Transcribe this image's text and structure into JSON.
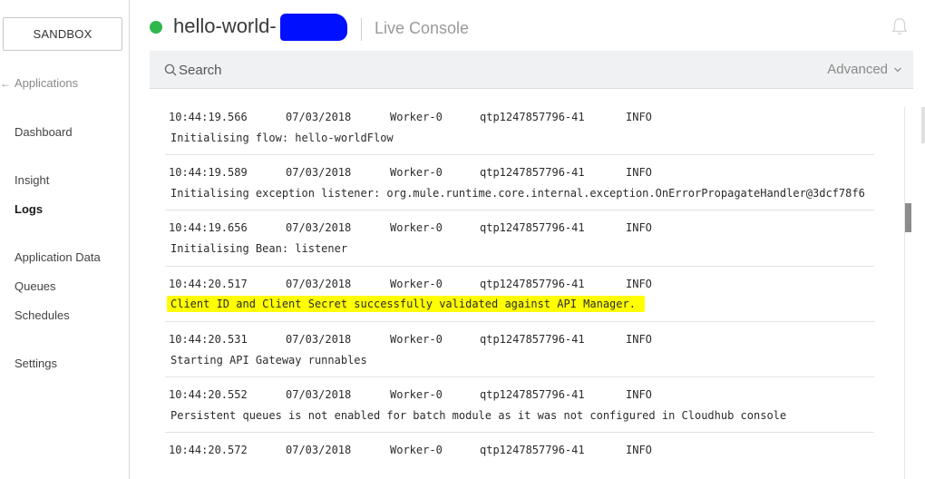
{
  "sidebar": {
    "environment": "SANDBOX",
    "back_label": "Applications",
    "items": [
      {
        "label": "Dashboard"
      },
      {
        "label": "Insight"
      },
      {
        "label": "Logs"
      },
      {
        "label": "Application Data"
      },
      {
        "label": "Queues"
      },
      {
        "label": "Schedules"
      },
      {
        "label": "Settings"
      }
    ]
  },
  "header": {
    "app_name": "hello-world-",
    "subtitle": "Live Console",
    "status_color": "#2eb84b"
  },
  "search": {
    "placeholder": "Search",
    "advanced_label": "Advanced"
  },
  "logs": [
    {
      "time": "10:44:19.566",
      "date": "07/03/2018",
      "worker": "Worker-0",
      "thread": "qtp1247857796-41",
      "level": "INFO",
      "message": "Initialising flow: hello-worldFlow"
    },
    {
      "time": "10:44:19.589",
      "date": "07/03/2018",
      "worker": "Worker-0",
      "thread": "qtp1247857796-41",
      "level": "INFO",
      "message": "Initialising exception listener: org.mule.runtime.core.internal.exception.OnErrorPropagateHandler@3dcf78f6"
    },
    {
      "time": "10:44:19.656",
      "date": "07/03/2018",
      "worker": "Worker-0",
      "thread": "qtp1247857796-41",
      "level": "INFO",
      "message": "Initialising Bean: listener"
    },
    {
      "time": "10:44:20.517",
      "date": "07/03/2018",
      "worker": "Worker-0",
      "thread": "qtp1247857796-41",
      "level": "INFO",
      "message": "Client ID and Client Secret successfully validated against API Manager."
    },
    {
      "time": "10:44:20.531",
      "date": "07/03/2018",
      "worker": "Worker-0",
      "thread": "qtp1247857796-41",
      "level": "INFO",
      "message": "Starting API Gateway runnables"
    },
    {
      "time": "10:44:20.552",
      "date": "07/03/2018",
      "worker": "Worker-0",
      "thread": "qtp1247857796-41",
      "level": "INFO",
      "message": "Persistent queues is not enabled for batch module as it was not configured in Cloudhub console"
    },
    {
      "time": "10:44:20.572",
      "date": "07/03/2018",
      "worker": "Worker-0",
      "thread": "qtp1247857796-41",
      "level": "INFO",
      "message": ""
    }
  ],
  "colors": {
    "highlight": "#ffff00",
    "redaction": "#0010ff"
  }
}
